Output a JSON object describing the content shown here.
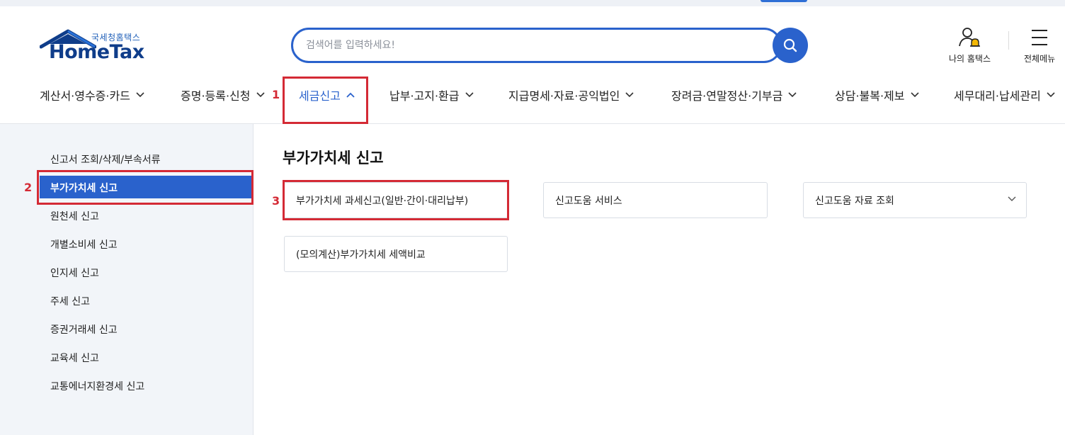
{
  "header": {
    "logo": {
      "korean": "국세청홈택스",
      "english": "HomeTax"
    },
    "search": {
      "placeholder": "검색어를 입력하세요!",
      "value": ""
    },
    "utility": {
      "my_hometax": "나의 홈택스",
      "all_menu": "전체메뉴"
    }
  },
  "nav": {
    "items": [
      {
        "label": "계산서·영수증·카드",
        "active": false
      },
      {
        "label": "증명·등록·신청",
        "active": false
      },
      {
        "label": "세금신고",
        "active": true
      },
      {
        "label": "납부·고지·환급",
        "active": false
      },
      {
        "label": "지급명세·자료·공익법인",
        "active": false
      },
      {
        "label": "장려금·연말정산·기부금",
        "active": false
      },
      {
        "label": "상담·불복·제보",
        "active": false
      },
      {
        "label": "세무대리·납세관리",
        "active": false
      }
    ]
  },
  "sidebar": {
    "items": [
      {
        "label": "신고서 조회/삭제/부속서류",
        "active": false
      },
      {
        "label": "부가가치세 신고",
        "active": true
      },
      {
        "label": "원천세 신고",
        "active": false
      },
      {
        "label": "개별소비세 신고",
        "active": false
      },
      {
        "label": "인지세 신고",
        "active": false
      },
      {
        "label": "주세 신고",
        "active": false
      },
      {
        "label": "증권거래세 신고",
        "active": false
      },
      {
        "label": "교육세 신고",
        "active": false
      },
      {
        "label": "교통에너지환경세 신고",
        "active": false
      }
    ]
  },
  "main": {
    "title": "부가가치세 신고",
    "cards": [
      {
        "label": "부가가치세 과세신고(일반·간이·대리납부)",
        "has_dropdown": false
      },
      {
        "label": "신고도움 서비스",
        "has_dropdown": false
      },
      {
        "label": "신고도움 자료 조회",
        "has_dropdown": true
      },
      {
        "label": "(모의계산)부가가치세 세액비교",
        "has_dropdown": false
      }
    ]
  },
  "annotations": {
    "step1": "1",
    "step2": "2",
    "step3": "3"
  },
  "colors": {
    "primary": "#2a62cc",
    "logo_navy": "#0f3d8a",
    "highlight_red": "#d42a35",
    "sidebar_bg": "#f2f5f9"
  }
}
